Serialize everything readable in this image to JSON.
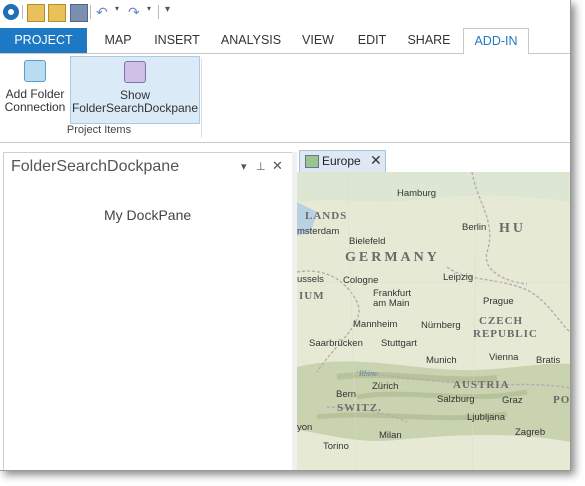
{
  "tabs": [
    "PROJECT",
    "MAP",
    "INSERT",
    "ANALYSIS",
    "VIEW",
    "EDIT",
    "SHARE",
    "ADD-IN"
  ],
  "ribbon": {
    "add_folder_label": "Add Folder Connection",
    "add_folder_line1": "Add Folder",
    "add_folder_line2": "Connection",
    "show_line1": "Show",
    "show_line2": "FolderSearchDockpane",
    "group_label": "Project Items"
  },
  "dockpane": {
    "title": "FolderSearchDockpane",
    "content": "My DockPane",
    "menu_glyph": "▾",
    "pin_glyph": "⊥",
    "close_glyph": "✕"
  },
  "map": {
    "tab_title": "Europe",
    "close_glyph": "✕",
    "countries": [
      "GERMANY",
      "CZECH",
      "REPUBLIC",
      "AUSTRIA",
      "SWITZ.",
      "POL",
      "HU",
      "IUM",
      "LANDS"
    ],
    "cities": [
      "Hamburg",
      "msterdam",
      "Berlin",
      "Bielefeld",
      "ussels",
      "Cologne",
      "Leipzig",
      "Frankfurt",
      "am Main",
      "Prague",
      "Mannheim",
      "Nürnberg",
      "Saarbrücken",
      "Stuttgart",
      "Munich",
      "Vienna",
      "Bratis",
      "Zürich",
      "Bern",
      "Salzburg",
      "Graz",
      "Ljubljana",
      "Zagreb",
      "Milan",
      "Torino",
      "yon"
    ],
    "lake": "Rhine"
  },
  "colors": {
    "accent": "#1e79c5",
    "project_tab_bg": "#1e79c5",
    "selected_button_bg": "#dbeaf7",
    "map_land": "#e6ead5",
    "map_mountain": "#c9d3b0"
  },
  "icons": {
    "app": "arcgis-pro-icon",
    "new": "new-project-icon",
    "open": "open-project-icon",
    "save": "save-icon",
    "undo": "undo-icon",
    "redo": "redo-icon"
  }
}
